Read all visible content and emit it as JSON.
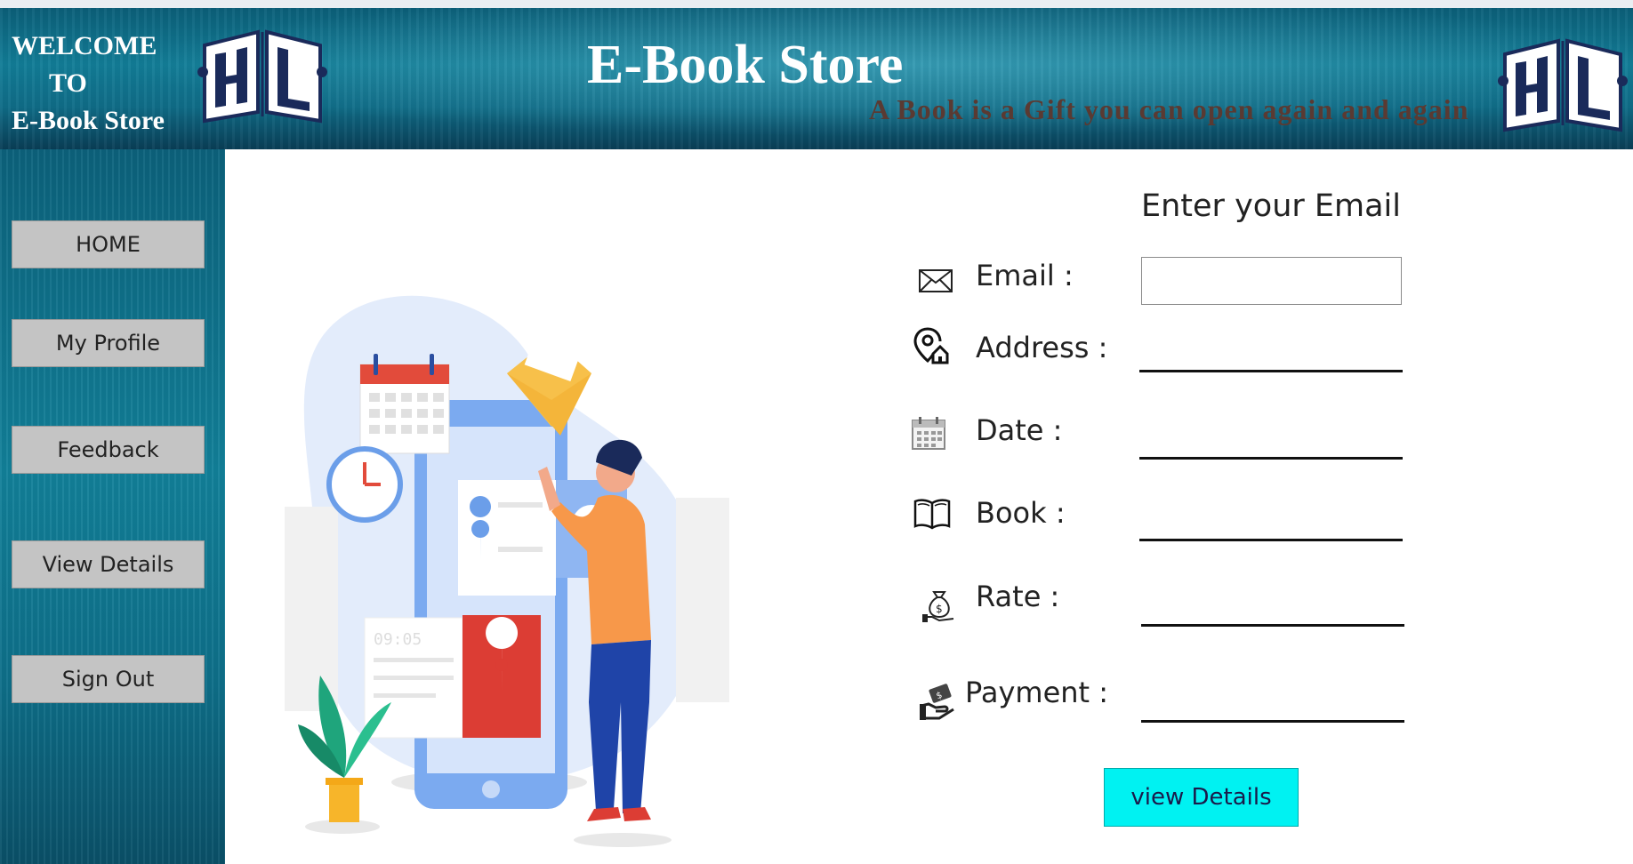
{
  "header": {
    "welcome_line1": "WELCOME",
    "welcome_line2": "TO",
    "welcome_line3": "E-Book Store",
    "title": "E-Book Store",
    "tagline": "A Book is a Gift you can open again and again"
  },
  "sidebar": {
    "items": [
      {
        "label": "HOME"
      },
      {
        "label": "My Profile"
      },
      {
        "label": "Feedback"
      },
      {
        "label": "View  Details"
      },
      {
        "label": "Sign Out"
      }
    ]
  },
  "form": {
    "heading": "Enter your Email",
    "email_label": "Email :",
    "email_value": "",
    "address_label": "Address :",
    "date_label": "Date :",
    "book_label": "Book :",
    "rate_label": "Rate   :",
    "payment_label": "Payment :",
    "submit_label": "view Details"
  },
  "illustration": {
    "clock_time": "09:05"
  },
  "colors": {
    "header_bg": "#0f6c87",
    "tagline": "#5a3a32",
    "button_bg": "#c4c4c4",
    "submit_bg": "#00f2f2"
  },
  "icons": {
    "logo": "open-book-logo-icon",
    "email": "envelope-icon",
    "address": "location-home-icon",
    "date": "calendar-icon",
    "book": "book-icon",
    "rate": "money-bag-icon",
    "payment": "payment-hand-icon"
  }
}
